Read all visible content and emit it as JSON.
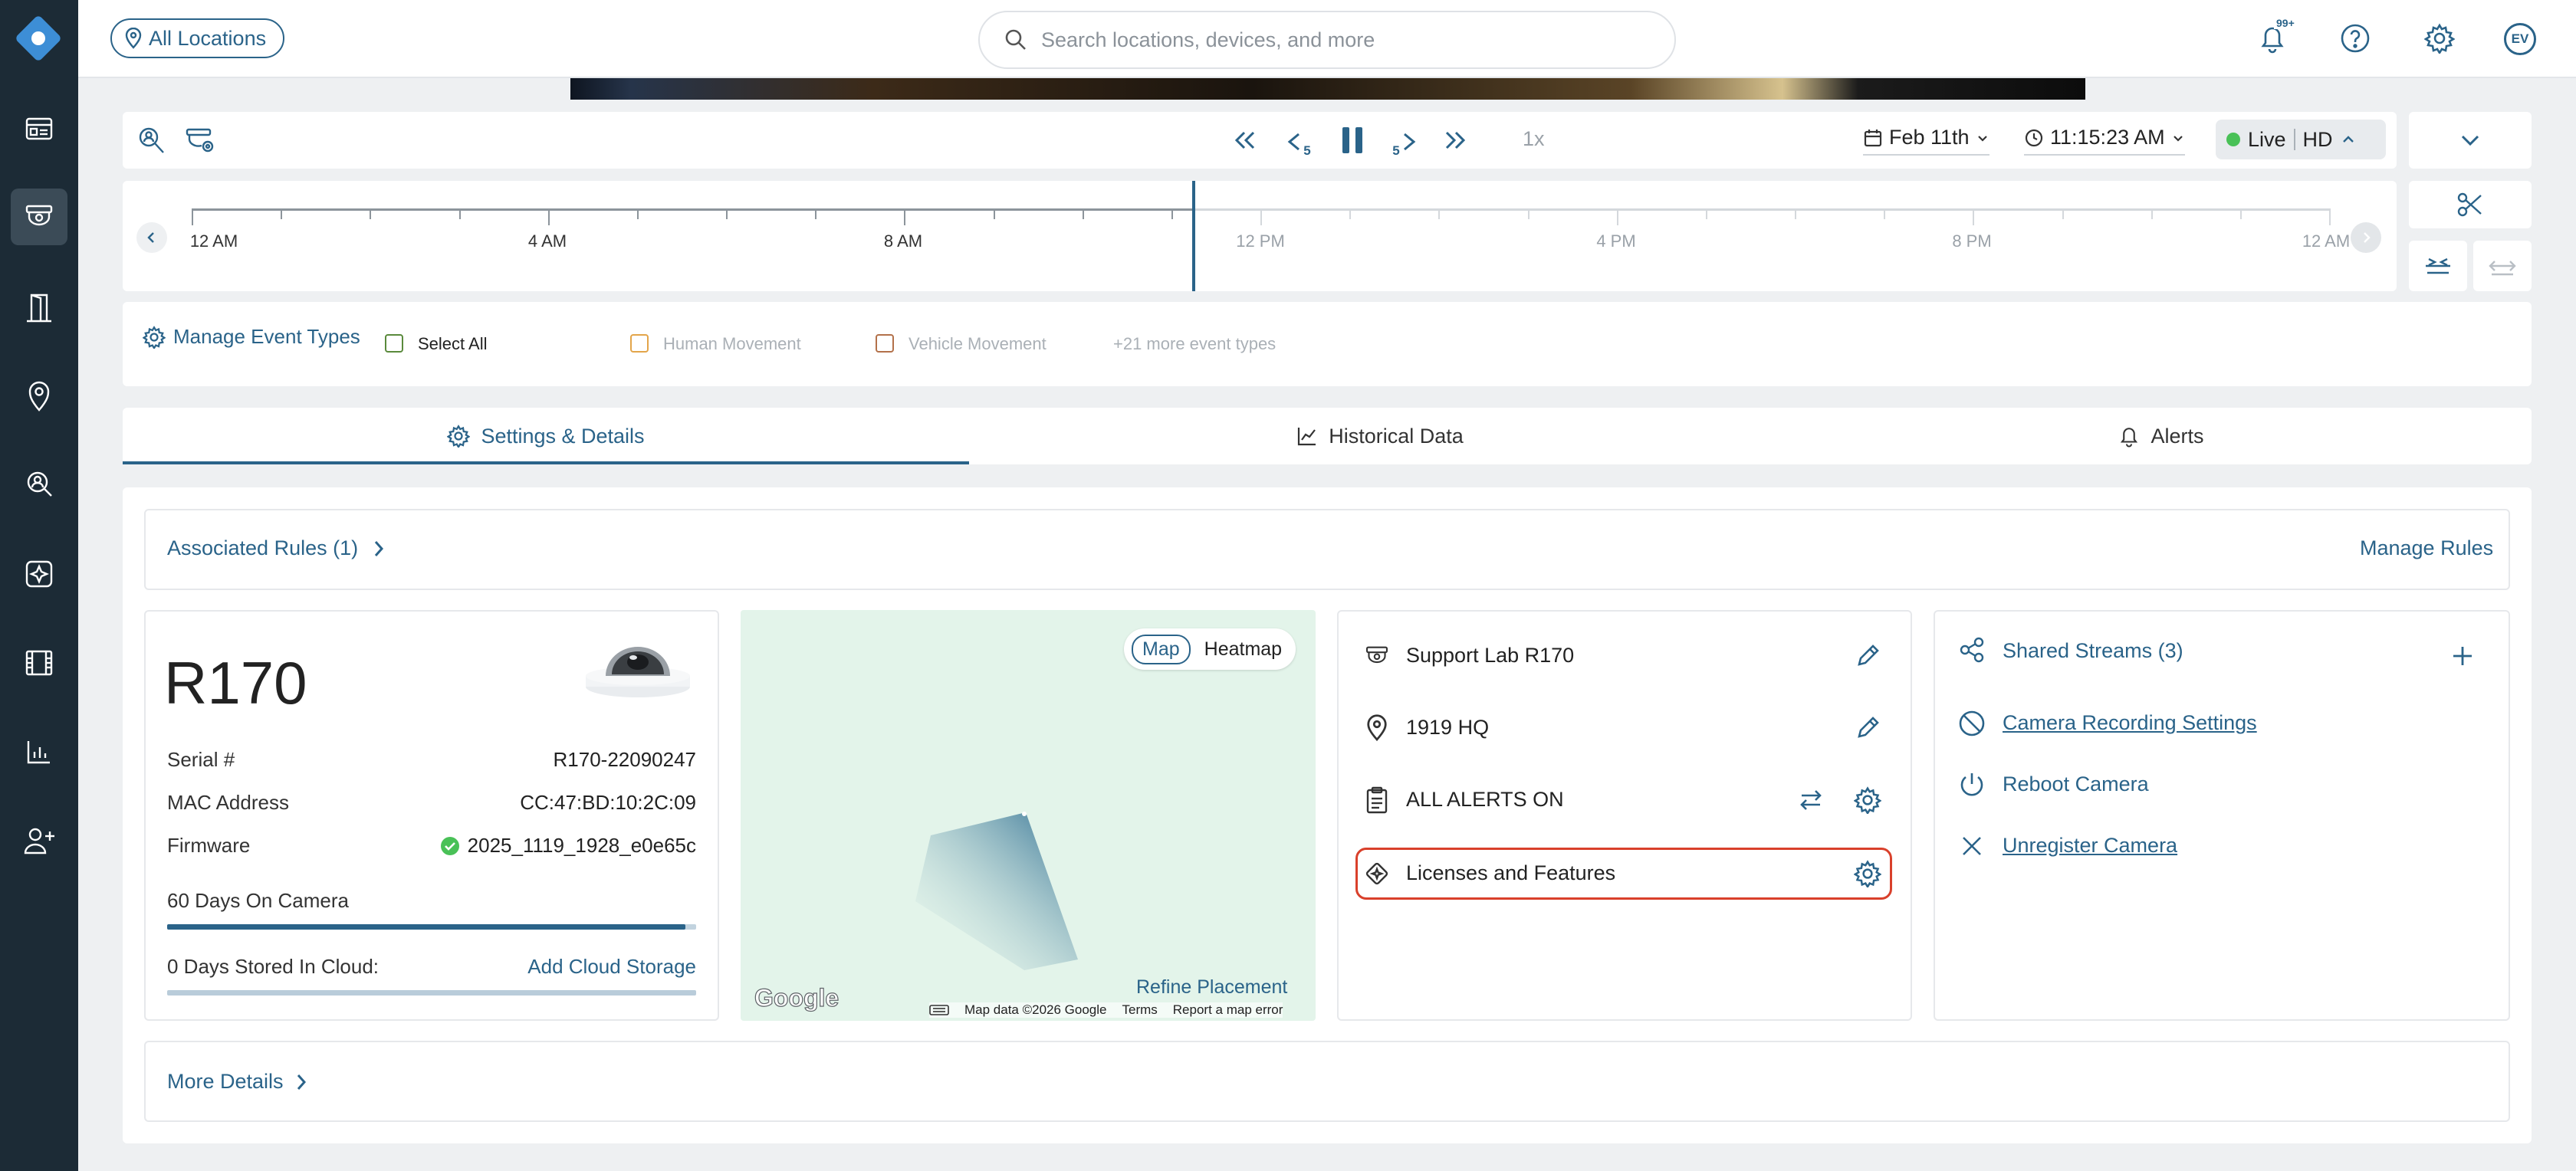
{
  "header": {
    "location_pill": "All Locations",
    "search_placeholder": "Search locations, devices, and more",
    "notifications_badge": "99+",
    "avatar_initials": "EV"
  },
  "player": {
    "speed": "1x",
    "date": "Feb 11th",
    "time": "11:15:23 AM",
    "live_label": "Live",
    "quality_label": "HD",
    "seek_back_seconds": "5",
    "seek_forward_seconds": "5"
  },
  "timeline": {
    "ticks": [
      "12 AM",
      "4 AM",
      "8 AM",
      "12 PM",
      "4 PM",
      "8 PM",
      "12 AM"
    ]
  },
  "events": {
    "manage_label": "Manage Event Types",
    "select_all": "Select All",
    "types": [
      "Human Movement",
      "Vehicle Movement"
    ],
    "more_label": "+21 more event types",
    "colors": {
      "select_all": "#5a8a3c",
      "human": "#e3a54a",
      "vehicle": "#b3714a"
    }
  },
  "tabs": [
    {
      "label": "Settings & Details",
      "active": true
    },
    {
      "label": "Historical Data",
      "active": false
    },
    {
      "label": "Alerts",
      "active": false
    }
  ],
  "rules": {
    "associated_label": "Associated Rules (1)",
    "manage_label": "Manage Rules"
  },
  "camera": {
    "model": "R170",
    "serial_label": "Serial #",
    "serial_value": "R170-22090247",
    "mac_label": "MAC Address",
    "mac_value": "CC:47:BD:10:2C:09",
    "firmware_label": "Firmware",
    "firmware_value": "2025_1119_1928_e0e65c",
    "on_camera_label": "60 Days On Camera",
    "on_camera_fill": 0.98,
    "cloud_label": "0 Days Stored In Cloud:",
    "cloud_action": "Add Cloud Storage",
    "cloud_fill": 0
  },
  "map": {
    "toggle_map": "Map",
    "toggle_heatmap": "Heatmap",
    "refine": "Refine Placement",
    "google_logo": "Google",
    "footer_data": "Map data ©2026 Google",
    "footer_terms": "Terms",
    "footer_report": "Report a map error"
  },
  "info": {
    "name": "Support Lab R170",
    "location": "1919 HQ",
    "alerts": "ALL ALERTS ON",
    "licenses": "Licenses and Features",
    "highlight_color": "#d9402b"
  },
  "actions": {
    "shared_streams": "Shared Streams (3)",
    "recording_settings": "Camera Recording Settings",
    "reboot": "Reboot Camera",
    "unregister": "Unregister Camera"
  },
  "more_details": "More Details",
  "colors": {
    "accent": "#2a6389",
    "sidebar": "#1c2b36",
    "live": "#49c157"
  }
}
